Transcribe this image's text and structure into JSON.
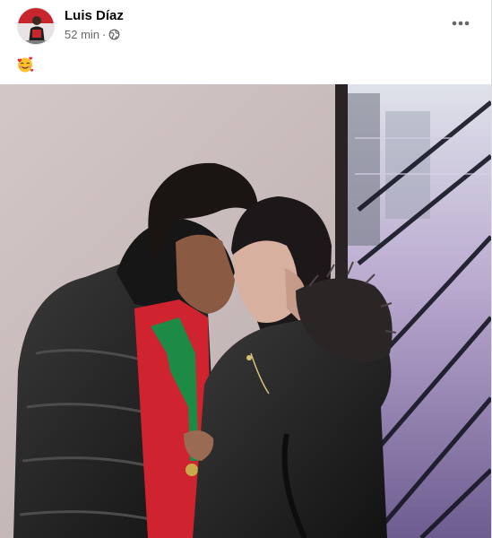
{
  "post": {
    "author": "Luis Díaz",
    "time": "52 min",
    "separator": "·",
    "privacy_icon": "globe-icon",
    "more_icon": "more-horizontal-icon",
    "caption_emoji": "smiling-face-with-hearts-emoji",
    "photo_icon": "photo"
  },
  "colors": {
    "author_text": "#050505",
    "meta_text": "#65676b",
    "divider": "#dddfe2"
  }
}
